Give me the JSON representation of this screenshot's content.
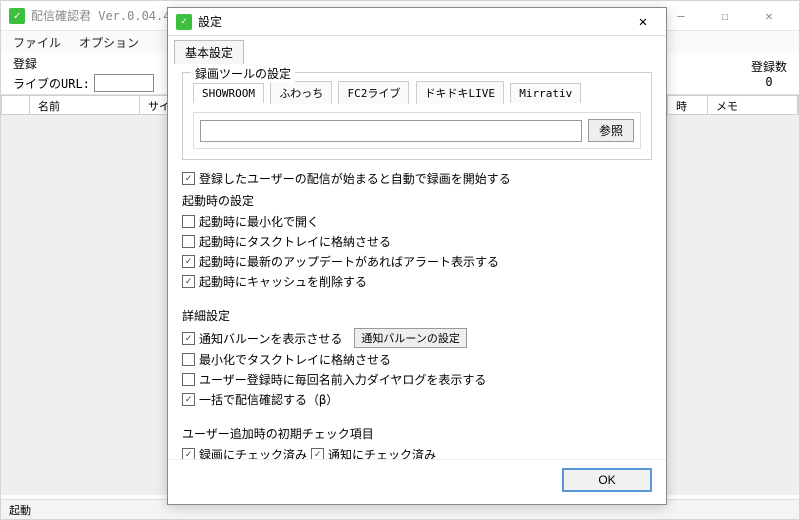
{
  "main": {
    "title": "配信確認君  Ver.0.04.4",
    "menu": {
      "file": "ファイル",
      "option": "オプション"
    },
    "toolbar": {
      "register": "登録",
      "url_label": "ライブのURL:"
    },
    "counter": {
      "label": "登録数",
      "value": "0"
    },
    "columns": {
      "name": "名前",
      "site": "サイ",
      "time": "時",
      "memo": "メモ"
    },
    "status": "起動"
  },
  "dialog": {
    "title": "設定",
    "tab_basic": "基本設定",
    "rec": {
      "legend": "録画ツールの設定",
      "services": [
        "SHOWROOM",
        "ふわっち",
        "FC2ライブ",
        "ドキドキLIVE",
        "Mirrativ"
      ],
      "browse": "参照",
      "auto_rec": "登録したユーザーの配信が始まると自動で録画を開始する"
    },
    "startup": {
      "legend": "起動時の設定",
      "o1": "起動時に最小化で開く",
      "o2": "起動時にタスクトレイに格納させる",
      "o3": "起動時に最新のアップデートがあればアラート表示する",
      "o4": "起動時にキャッシュを削除する"
    },
    "detail": {
      "legend": "詳細設定",
      "o1": "通知バルーンを表示させる",
      "o1_btn": "通知バルーンの設定",
      "o2": "最小化でタスクトレイに格納させる",
      "o3": "ユーザー登録時に毎回名前入力ダイヤログを表示する",
      "o4": "一括で配信確認する（β）"
    },
    "initchk": {
      "legend": "ユーザー追加時の初期チェック項目",
      "o1": "録画にチェック済み",
      "o2": "通知にチェック済み"
    },
    "ok": "OK"
  },
  "checks": {
    "rec_auto": true,
    "s1": false,
    "s2": false,
    "s3": true,
    "s4": true,
    "d1": true,
    "d2": false,
    "d3": false,
    "d4": true,
    "i1": true,
    "i2": true
  }
}
